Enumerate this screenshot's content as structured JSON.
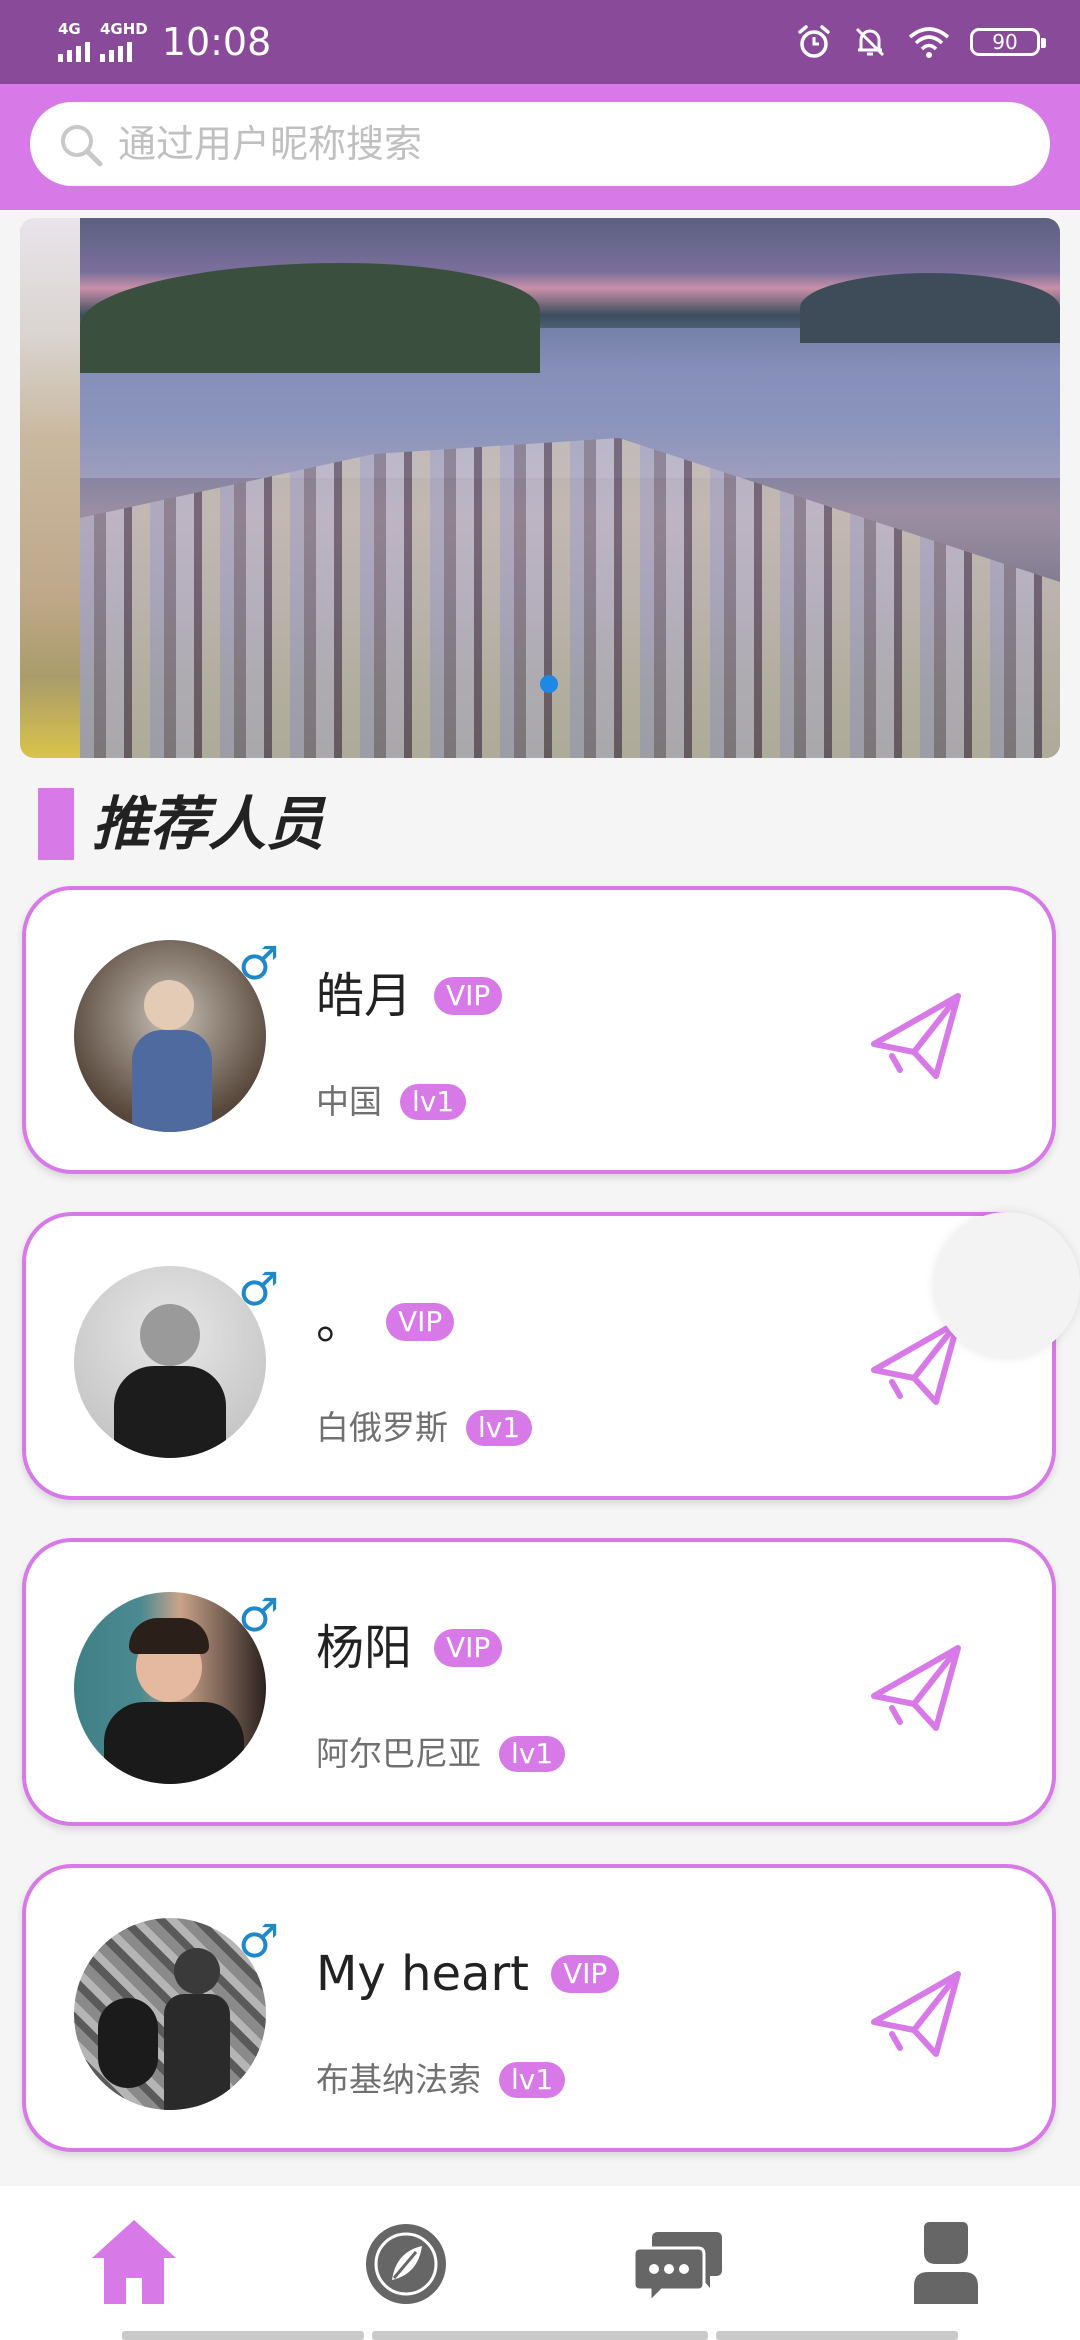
{
  "status_bar": {
    "signal_1": "4G",
    "signal_2": "4GHD",
    "time": "10:08",
    "battery": "90"
  },
  "search": {
    "placeholder": "通过用户昵称搜索"
  },
  "section": {
    "title": "推荐人员"
  },
  "people": [
    {
      "name": "皓月",
      "vip": "VIP",
      "country": "中国",
      "level": "lv1",
      "gender": "♂"
    },
    {
      "name": "。",
      "vip": "VIP",
      "country": "白俄罗斯",
      "level": "lv1",
      "gender": "♂"
    },
    {
      "name": "杨阳",
      "vip": "VIP",
      "country": "阿尔巴尼亚",
      "level": "lv1",
      "gender": "♂"
    },
    {
      "name": "My heart",
      "vip": "VIP",
      "country": "布基纳法索",
      "level": "lv1",
      "gender": "♂"
    }
  ],
  "nav": {
    "items": [
      {
        "icon": "home-icon",
        "active": true
      },
      {
        "icon": "discover-icon",
        "active": false
      },
      {
        "icon": "messages-icon",
        "active": false
      },
      {
        "icon": "profile-icon",
        "active": false
      }
    ]
  },
  "colors": {
    "accent": "#d879e8",
    "status_bar": "#8a4a9a",
    "gender": "#1e88c8",
    "nav_inactive": "#666666"
  }
}
